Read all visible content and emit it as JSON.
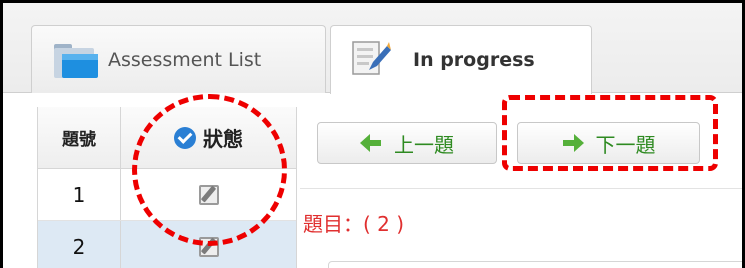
{
  "tabs": [
    {
      "label": "Assessment List",
      "icon": "folder-icon",
      "active": false
    },
    {
      "label": "In progress",
      "icon": "notepad-pencil-icon",
      "active": true
    }
  ],
  "question_table": {
    "header_number": "題號",
    "header_status": "狀態",
    "rows": [
      {
        "number": "1",
        "status_icon": "edit-icon",
        "selected": false
      },
      {
        "number": "2",
        "status_icon": "edit-icon",
        "selected": true
      }
    ]
  },
  "navigation": {
    "prev_label": "上一題",
    "next_label": "下一題"
  },
  "question": {
    "title": "題目：( 2 )"
  },
  "colors": {
    "annotation": "#ee0000",
    "nav_text": "#2e8a21",
    "question_title": "#e02f2f",
    "status_check": "#2a7fd4",
    "selected_row": "#dde9f4"
  }
}
